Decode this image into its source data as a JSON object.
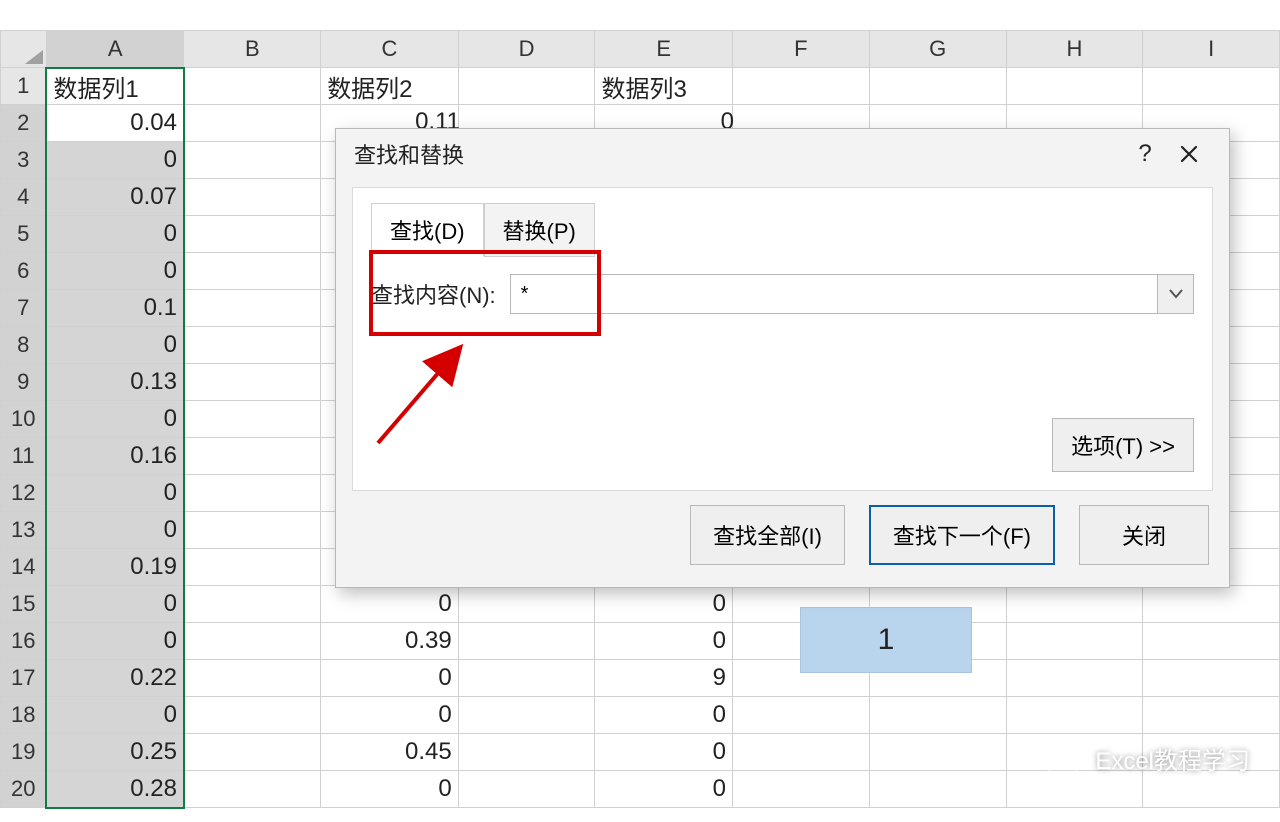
{
  "columns": [
    "A",
    "B",
    "C",
    "D",
    "E",
    "F",
    "G",
    "H",
    "I"
  ],
  "rowCount": 20,
  "headers": {
    "A": "数据列1",
    "C": "数据列2",
    "E": "数据列3"
  },
  "colA": [
    "0.04",
    "0",
    "0.07",
    "0",
    "0",
    "0.1",
    "0",
    "0.13",
    "0",
    "0.16",
    "0",
    "0",
    "0.19",
    "0",
    "0",
    "0.22",
    "0",
    "0.25",
    "0.28"
  ],
  "colC": {
    "15": "0",
    "16": "0.39",
    "17": "0",
    "18": "0",
    "19": "0.45",
    "20": "0"
  },
  "colE": {
    "15": "0",
    "16": "0",
    "17": "9",
    "18": "0",
    "19": "0",
    "20": "0"
  },
  "partialC2": "0.11",
  "partialE2": "0",
  "highlight": {
    "value": "1"
  },
  "dialog": {
    "title": "查找和替换",
    "tab_find": "查找(D)",
    "tab_replace": "替换(P)",
    "find_label": "查找内容(N):",
    "find_value": "*",
    "options": "选项(T) >>",
    "btn_findall": "查找全部(I)",
    "btn_findnext": "查找下一个(F)",
    "btn_close": "关闭",
    "help": "?"
  },
  "watermark": "Excel教程学习"
}
